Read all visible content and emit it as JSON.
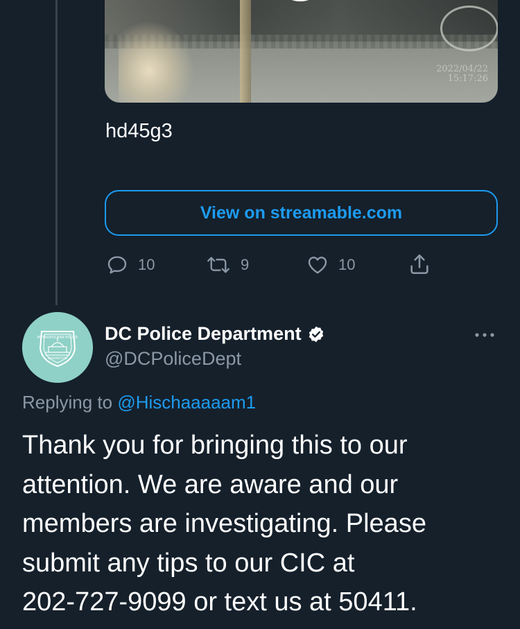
{
  "video": {
    "timestamp_date": "2022/04/22",
    "timestamp_time": "15:17:26"
  },
  "previous_tweet": {
    "text": "hd45g3",
    "link_button_label": "View on streamable.com",
    "actions": {
      "reply_count": "10",
      "retweet_count": "9",
      "like_count": "10"
    }
  },
  "reply_tweet": {
    "author_name": "DC Police Department",
    "author_handle": "@DCPoliceDept",
    "verified": true,
    "replying_to_prefix": "Replying to ",
    "replying_to_handle": "@Hischaaaaam1",
    "body_lines": [
      "Thank you for bringing this to our",
      "attention. We are aware and our",
      "members are investigating. Please",
      "submit any tips to our CIC at",
      "202-727-9099 or text us at 50411."
    ],
    "avatar_badge_text": {
      "top": "METROPOLITAN POLICE",
      "bottom": "WASHINGTON"
    }
  },
  "colors": {
    "background": "#15202b",
    "accent": "#1d9bf0",
    "muted_text": "#8b98a5",
    "thread_line": "#38444d",
    "avatar_bg": "#8fd1c7"
  },
  "icons": {
    "reply": "reply-icon",
    "retweet": "retweet-icon",
    "like": "heart-icon",
    "share": "share-icon",
    "verified": "verified-badge-icon",
    "more": "more-options-icon"
  }
}
